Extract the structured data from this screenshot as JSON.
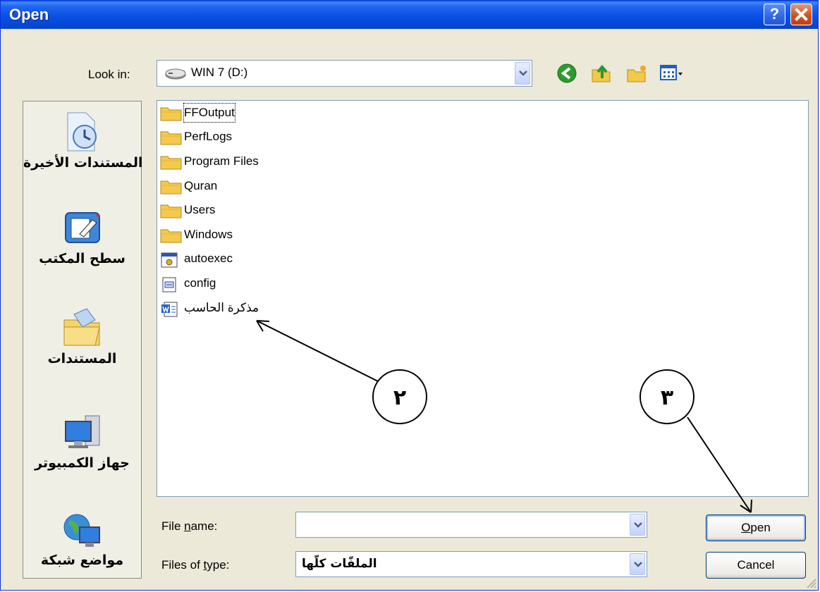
{
  "window": {
    "title": "Open"
  },
  "look_in": {
    "label": "Look in:",
    "value": "WIN 7 (D:)"
  },
  "places": [
    {
      "label": "المستندات الأخيرة"
    },
    {
      "label": "سطح المكتب"
    },
    {
      "label": "المستندات"
    },
    {
      "label": "جهاز الكمبيوتر"
    },
    {
      "label": "مواضع شبكة"
    }
  ],
  "files": [
    {
      "name": "FFOutput",
      "type": "folder"
    },
    {
      "name": "PerfLogs",
      "type": "folder"
    },
    {
      "name": "Program Files",
      "type": "folder"
    },
    {
      "name": "Quran",
      "type": "folder"
    },
    {
      "name": "Users",
      "type": "folder"
    },
    {
      "name": "Windows",
      "type": "folder"
    },
    {
      "name": "autoexec",
      "type": "batch"
    },
    {
      "name": "config",
      "type": "settings"
    },
    {
      "name": "مذكرة الحاسب",
      "type": "word"
    }
  ],
  "file_name": {
    "label": "File name:",
    "value": ""
  },
  "file_type": {
    "label": "Files of type:",
    "value": "الملفّات كلّها"
  },
  "buttons": {
    "open": "Open",
    "cancel": "Cancel"
  },
  "annotations": {
    "marker_2": "٢",
    "marker_3": "٣"
  },
  "colors": {
    "title_bar": "#0a53e0",
    "accent_border": "#7f9db9",
    "dialog_bg": "#ece9d8"
  }
}
